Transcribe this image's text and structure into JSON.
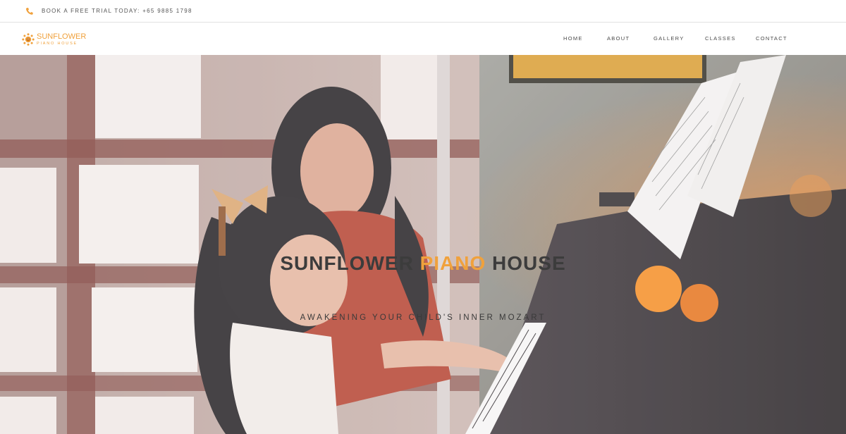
{
  "topbar": {
    "trial_text": "BOOK A FREE TRIAL TODAY: +65 9885 1798",
    "icon": "phone-icon"
  },
  "logo": {
    "top": "SUNFLOWER",
    "bottom": "PIANO HOUSE",
    "icon": "sunflower-icon"
  },
  "nav": {
    "home": "HOME",
    "about": "ABOUT",
    "gallery": "GALLERY",
    "classes": "CLASSES",
    "contact": "CONTACT"
  },
  "hero": {
    "title_part1": "SUNFLOWER ",
    "title_accent": "PIANO",
    "title_part2": " HOUSE",
    "subtitle": "AWAKENING YOUR CHILD'S INNER MOZART"
  },
  "colors": {
    "accent": "#f0a13c",
    "text_dark": "#3c3c3c",
    "nav_text": "#4a4a4a"
  }
}
